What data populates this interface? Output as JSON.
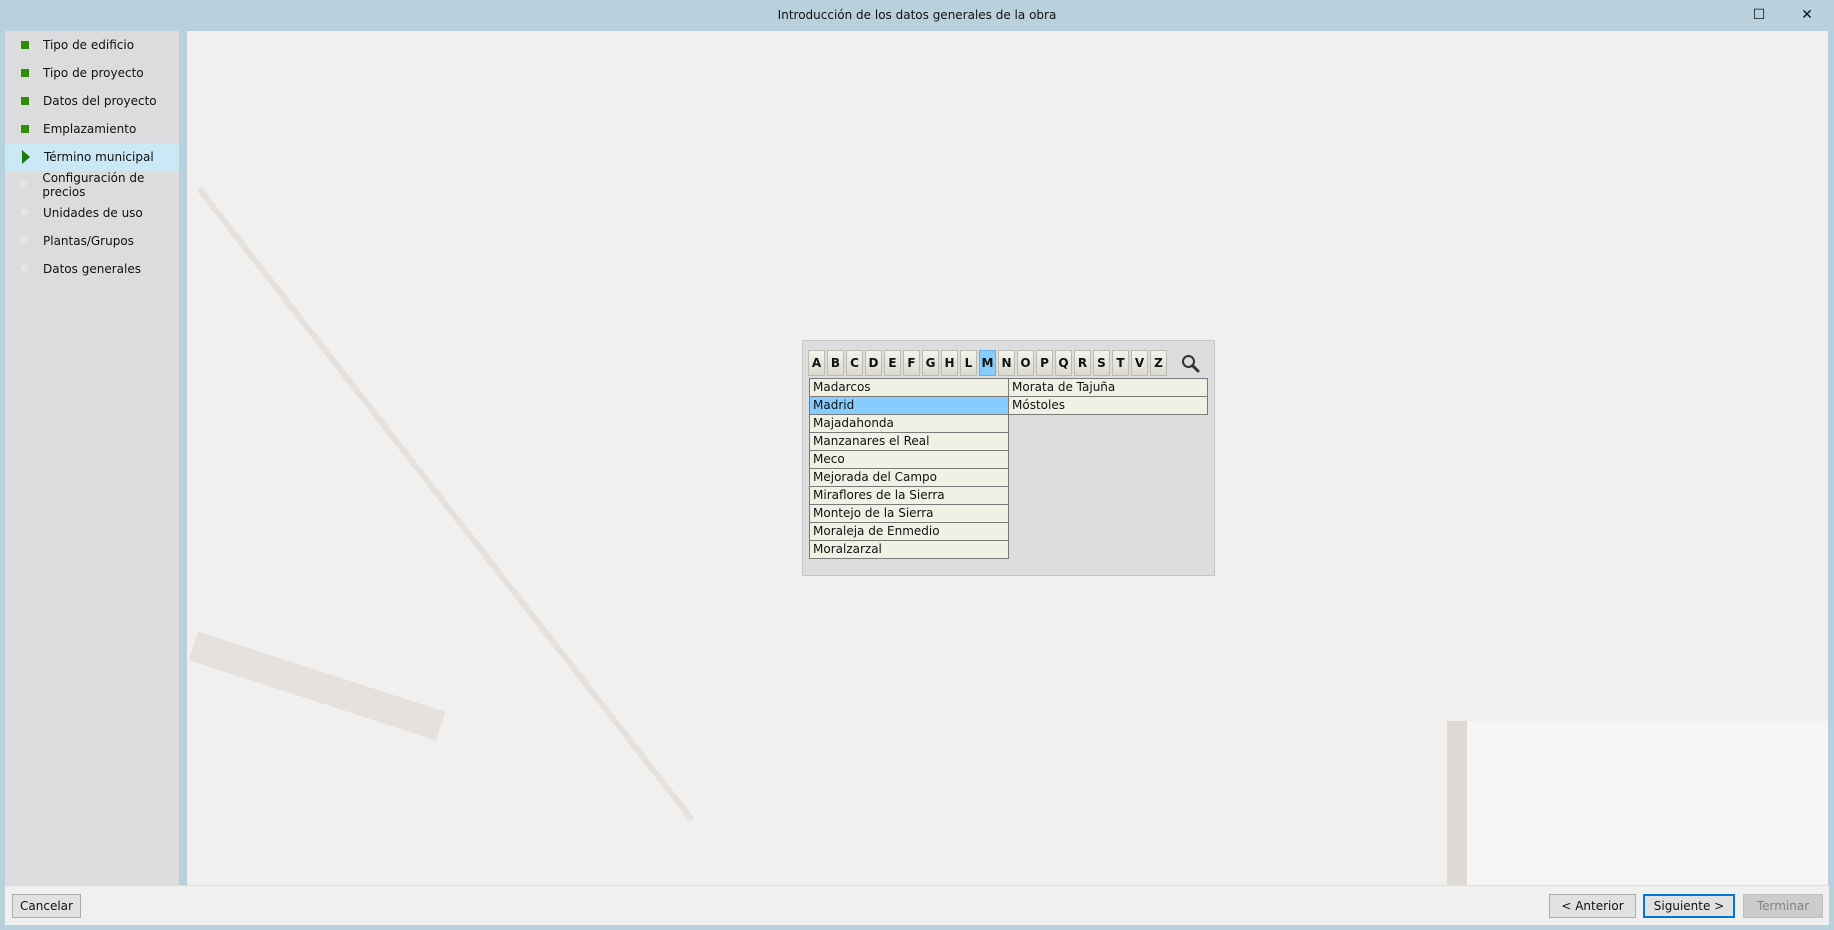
{
  "window": {
    "title": "Introducción de los datos generales de la obra"
  },
  "sidebar": {
    "items": [
      {
        "label": "Tipo de edificio",
        "state": "done"
      },
      {
        "label": "Tipo de proyecto",
        "state": "done"
      },
      {
        "label": "Datos del proyecto",
        "state": "done"
      },
      {
        "label": "Emplazamiento",
        "state": "done"
      },
      {
        "label": "Término municipal",
        "state": "current"
      },
      {
        "label": "Configuración de precios",
        "state": "pending"
      },
      {
        "label": "Unidades de uso",
        "state": "pending"
      },
      {
        "label": "Plantas/Grupos",
        "state": "pending"
      },
      {
        "label": "Datos generales",
        "state": "pending"
      }
    ]
  },
  "letters": [
    "A",
    "B",
    "C",
    "D",
    "E",
    "F",
    "G",
    "H",
    "L",
    "M",
    "N",
    "O",
    "P",
    "Q",
    "R",
    "S",
    "T",
    "V",
    "Z"
  ],
  "selected_letter": "M",
  "municipios": {
    "col1": [
      "Madarcos",
      "Madrid",
      "Majadahonda",
      "Manzanares el Real",
      "Meco",
      "Mejorada del Campo",
      "Miraflores de la Sierra",
      "Montejo de la Sierra",
      "Moraleja de Enmedio",
      "Moralzarzal"
    ],
    "col2": [
      "Morata de Tajuña",
      "Móstoles"
    ],
    "selected": "Madrid"
  },
  "footer": {
    "cancel": "Cancelar",
    "back": "< Anterior",
    "next": "Siguiente >",
    "finish": "Terminar"
  },
  "colors": {
    "accent": "#0078d7",
    "selection": "#86cdfd",
    "done": "#2f8d08"
  }
}
